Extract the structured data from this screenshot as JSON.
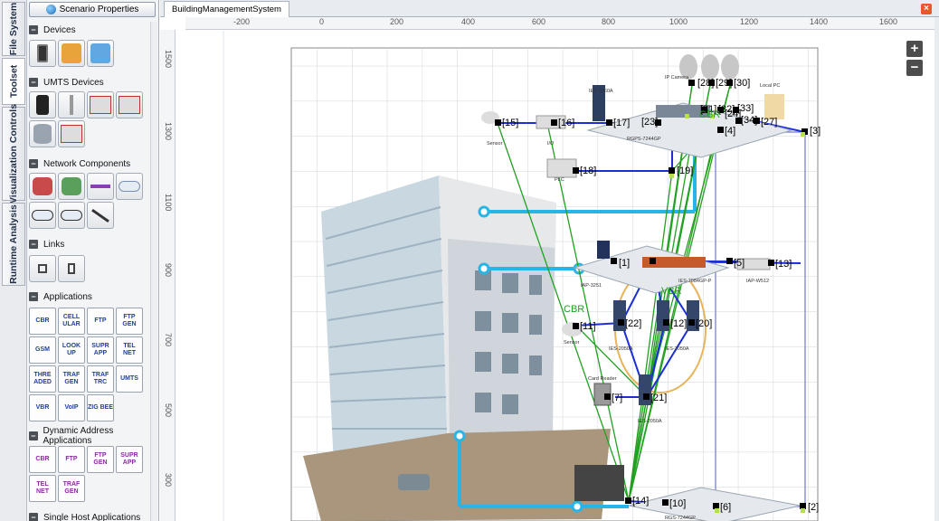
{
  "sidebar_tabs": [
    "File System",
    "Toolset",
    "Visualization Controls",
    "Runtime Analysis"
  ],
  "toolset": {
    "scenario_button": "Scenario Properties",
    "sections": {
      "devices": "Devices",
      "umts": "UMTS Devices",
      "network": "Network Components",
      "links": "Links",
      "applications": "Applications",
      "dynamic": "Dynamic Address Applications",
      "single": "Single Host Applications"
    },
    "apps": [
      "CBR",
      "CELL ULAR",
      "FTP",
      "FTP GEN",
      "GSM",
      "LOOK UP",
      "SUPR APP",
      "TEL NET",
      "THRE ADED",
      "TRAF GEN",
      "TRAF TRC",
      "UMTS",
      "VBR",
      "VoIP",
      "ZIG BEE"
    ],
    "dyn_apps": [
      "CBR",
      "FTP",
      "FTP GEN",
      "SUPR APP",
      "TEL NET",
      "TRAF GEN"
    ]
  },
  "canvas": {
    "tab_title": "BuildingManagementSystem",
    "close_icon": "close-icon",
    "hruler": [
      "-200",
      "0",
      "200",
      "400",
      "600",
      "800",
      "1000",
      "1200",
      "1400",
      "1600"
    ],
    "vruler": [
      "1500",
      "1300",
      "1100",
      "900",
      "700",
      "500",
      "300"
    ],
    "zoom_in": "+",
    "zoom_out": "−",
    "device_labels": [
      "IP Camera",
      "Local PC",
      "IES-1060A",
      "RGPS-7244GP",
      "Sensor",
      "I/O",
      "PLC",
      "IAP-3251",
      "IES-7084GP-P",
      "IAP-W512",
      "Sensor",
      "IES-2050A",
      "Card Reader",
      "IES-2050A",
      "IES-2050A",
      "RGS-7244GP"
    ],
    "node_labels": [
      "[1]",
      "[2]",
      "[3]",
      "[4]",
      "[5]",
      "[6]",
      "[7]",
      "[10]",
      "[11]",
      "[12]",
      "[13]",
      "[14]",
      "[15]",
      "[16]",
      "[17]",
      "[18]",
      "[19]",
      "[20]",
      "[21]",
      "[22]",
      "[23]",
      "[27]",
      "[28]",
      "[29]",
      "[30]",
      "[31]",
      "[32]",
      "[33]",
      "[34]",
      "[24]"
    ],
    "app_labels": [
      "CBR",
      "VBR",
      "CBR"
    ]
  }
}
